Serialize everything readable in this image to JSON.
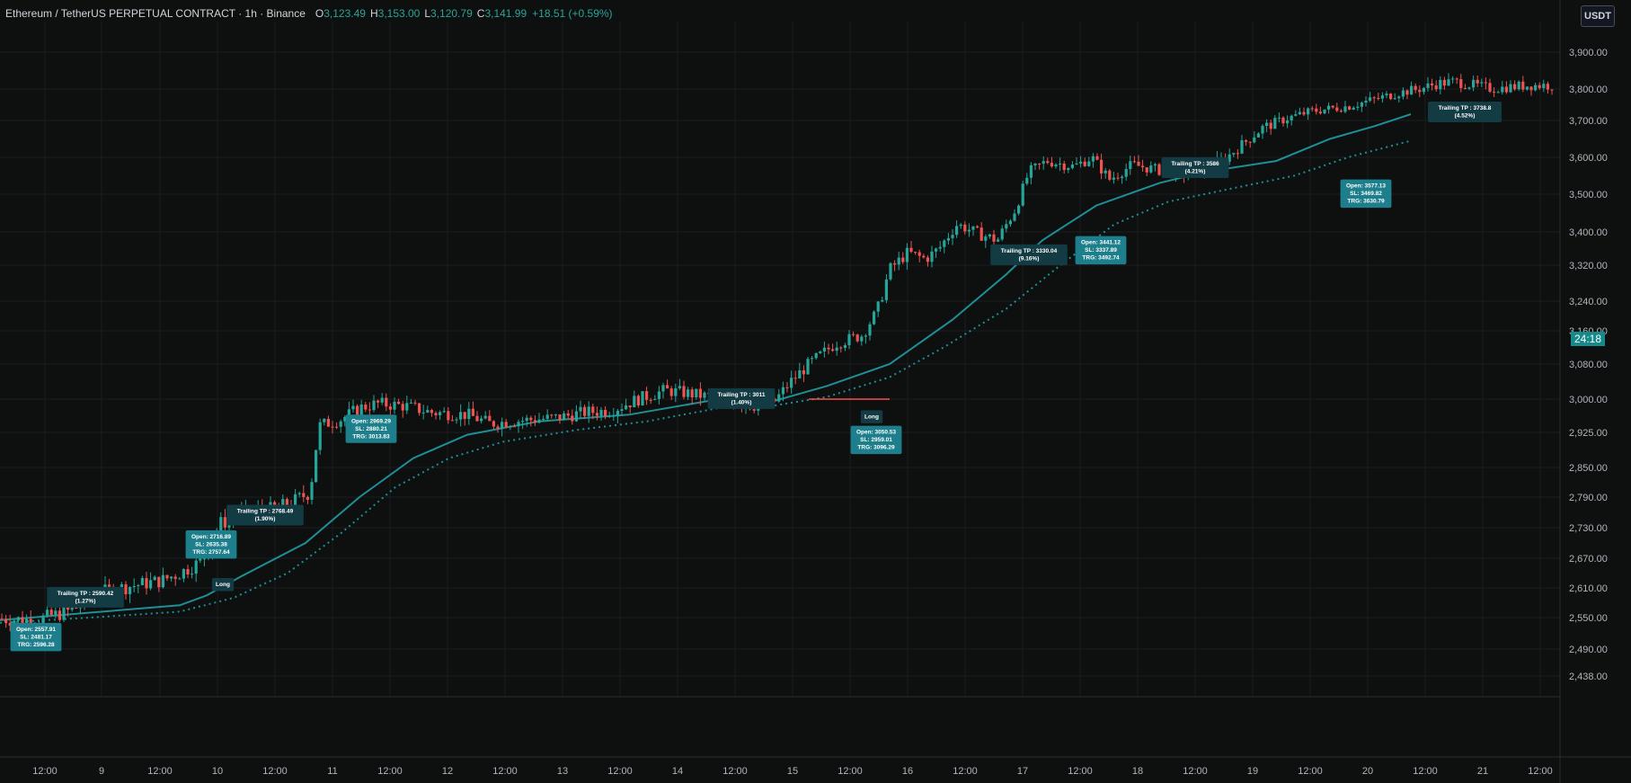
{
  "header": {
    "symbol": "Ethereum / TetherUS PERPETUAL CONTRACT · 1h · Binance",
    "ohlc": [
      {
        "k": "O",
        "v": "3,123.49"
      },
      {
        "k": "H",
        "v": "3,153.00"
      },
      {
        "k": "L",
        "v": "3,120.79"
      },
      {
        "k": "C",
        "v": "3,141.99"
      }
    ],
    "change": "+18.51 (+0.59%)"
  },
  "currency_button": "USDT",
  "countdown": "24:18",
  "colors": {
    "bull": "#26a69a",
    "bear": "#ef5350",
    "ma": "#1e8f96",
    "ann_bg": "#1d7f8c",
    "ann_bg_dark": "#133b44"
  },
  "chart_data": {
    "type": "candlestick",
    "price_axis": [
      "3,900.00",
      "3,800.00",
      "3,700.00",
      "3,600.00",
      "3,500.00",
      "3,400.00",
      "3,320.00",
      "3,240.00",
      "3,160.00",
      "3,080.00",
      "3,000.00",
      "2,925.00",
      "2,850.00",
      "2,790.00",
      "2,730.00",
      "2,670.00",
      "2,610.00",
      "2,550.00",
      "2,490.00",
      "2,438.00"
    ],
    "time_axis": [
      "12:00",
      "9",
      "12:00",
      "10",
      "12:00",
      "11",
      "12:00",
      "12",
      "12:00",
      "13",
      "12:00",
      "14",
      "12:00",
      "15",
      "12:00",
      "16",
      "12:00",
      "17",
      "12:00",
      "18",
      "12:00",
      "19",
      "12:00",
      "20",
      "12:00",
      "21",
      "12:00"
    ],
    "ylim": [
      2438,
      3900
    ],
    "price_path": [
      [
        0,
        2548
      ],
      [
        40,
        2545
      ],
      [
        80,
        2565
      ],
      [
        110,
        2600
      ],
      [
        140,
        2612
      ],
      [
        180,
        2625
      ],
      [
        200,
        2640
      ],
      [
        225,
        2665
      ],
      [
        245,
        2738
      ],
      [
        275,
        2760
      ],
      [
        300,
        2765
      ],
      [
        320,
        2775
      ],
      [
        345,
        2800
      ],
      [
        355,
        2940
      ],
      [
        380,
        2955
      ],
      [
        400,
        2980
      ],
      [
        420,
        2990
      ],
      [
        450,
        2985
      ],
      [
        480,
        2970
      ],
      [
        520,
        2965
      ],
      [
        545,
        2945
      ],
      [
        580,
        2952
      ],
      [
        620,
        2958
      ],
      [
        650,
        2970
      ],
      [
        680,
        2975
      ],
      [
        710,
        3000
      ],
      [
        740,
        3020
      ],
      [
        760,
        3015
      ],
      [
        790,
        3005
      ],
      [
        820,
        2990
      ],
      [
        845,
        2985
      ],
      [
        860,
        2990
      ],
      [
        880,
        3040
      ],
      [
        900,
        3080
      ],
      [
        930,
        3130
      ],
      [
        960,
        3150
      ],
      [
        975,
        3210
      ],
      [
        990,
        3310
      ],
      [
        1010,
        3350
      ],
      [
        1030,
        3335
      ],
      [
        1045,
        3360
      ],
      [
        1065,
        3420
      ],
      [
        1090,
        3395
      ],
      [
        1110,
        3380
      ],
      [
        1130,
        3460
      ],
      [
        1145,
        3560
      ],
      [
        1165,
        3590
      ],
      [
        1195,
        3575
      ],
      [
        1215,
        3600
      ],
      [
        1235,
        3540
      ],
      [
        1260,
        3580
      ],
      [
        1290,
        3565
      ],
      [
        1320,
        3555
      ],
      [
        1340,
        3570
      ],
      [
        1365,
        3600
      ],
      [
        1385,
        3640
      ],
      [
        1405,
        3680
      ],
      [
        1430,
        3705
      ],
      [
        1460,
        3730
      ],
      [
        1500,
        3745
      ],
      [
        1520,
        3760
      ],
      [
        1540,
        3775
      ],
      [
        1560,
        3790
      ],
      [
        1580,
        3800
      ],
      [
        1600,
        3815
      ],
      [
        1620,
        3820
      ],
      [
        1660,
        3800
      ],
      [
        1700,
        3810
      ],
      [
        1740,
        3810
      ]
    ],
    "ma_path": [
      [
        0,
        2545
      ],
      [
        100,
        2560
      ],
      [
        200,
        2575
      ],
      [
        230,
        2595
      ],
      [
        270,
        2635
      ],
      [
        340,
        2700
      ],
      [
        400,
        2790
      ],
      [
        460,
        2870
      ],
      [
        520,
        2920
      ],
      [
        600,
        2950
      ],
      [
        700,
        2965
      ],
      [
        800,
        3000
      ],
      [
        860,
        2995
      ],
      [
        920,
        3030
      ],
      [
        990,
        3080
      ],
      [
        1060,
        3190
      ],
      [
        1120,
        3300
      ],
      [
        1160,
        3380
      ],
      [
        1220,
        3470
      ],
      [
        1290,
        3530
      ],
      [
        1340,
        3560
      ],
      [
        1420,
        3590
      ],
      [
        1480,
        3650
      ],
      [
        1530,
        3685
      ],
      [
        1570,
        3720
      ]
    ],
    "ma2_path": [
      [
        0,
        2540
      ],
      [
        100,
        2550
      ],
      [
        200,
        2562
      ],
      [
        260,
        2590
      ],
      [
        320,
        2640
      ],
      [
        380,
        2720
      ],
      [
        440,
        2810
      ],
      [
        500,
        2870
      ],
      [
        560,
        2905
      ],
      [
        640,
        2930
      ],
      [
        720,
        2950
      ],
      [
        800,
        2980
      ],
      [
        860,
        2985
      ],
      [
        920,
        3005
      ],
      [
        990,
        3050
      ],
      [
        1050,
        3120
      ],
      [
        1120,
        3220
      ],
      [
        1180,
        3320
      ],
      [
        1240,
        3420
      ],
      [
        1300,
        3480
      ],
      [
        1360,
        3510
      ],
      [
        1440,
        3550
      ],
      [
        1500,
        3600
      ],
      [
        1570,
        3645
      ]
    ],
    "annotations": [
      {
        "dark": false,
        "lines": [
          "Open: 2557.91",
          "SL: 2481.17",
          "TRG: 2596.28"
        ],
        "x": 40,
        "y": 2540
      },
      {
        "dark": true,
        "lines": [
          "Trailing TP : 2590.42",
          "(1.27%)"
        ],
        "x": 95,
        "y": 2612
      },
      {
        "dark": false,
        "lines": [
          "Open: 2716.89",
          "SL: 2635.38",
          "TRG: 2757.64"
        ],
        "x": 235,
        "y": 2725
      },
      {
        "dark": true,
        "lines": [
          "Long"
        ],
        "x": 248,
        "y": 2630
      },
      {
        "dark": true,
        "lines": [
          "Trailing TP : 2768.49",
          "(1.90%)"
        ],
        "x": 295,
        "y": 2775
      },
      {
        "dark": false,
        "lines": [
          "Open: 2969.29",
          "SL: 2880.21",
          "TRG: 3013.83"
        ],
        "x": 413,
        "y": 2965
      },
      {
        "dark": true,
        "lines": [
          "Trailing TP : 3011",
          "(1.40%)"
        ],
        "x": 825,
        "y": 3025
      },
      {
        "dark": true,
        "lines": [
          "Long"
        ],
        "x": 970,
        "y": 2975
      },
      {
        "dark": false,
        "lines": [
          "Open: 3050.53",
          "SL: 2959.01",
          "TRG: 3096.29"
        ],
        "x": 975,
        "y": 2940
      },
      {
        "dark": true,
        "lines": [
          "Trailing TP : 3330.04",
          "(9.16%)"
        ],
        "x": 1145,
        "y": 3370
      },
      {
        "dark": false,
        "lines": [
          "Open: 3441.12",
          "SL: 3337.89",
          "TRG: 3492.74"
        ],
        "x": 1225,
        "y": 3390
      },
      {
        "dark": true,
        "lines": [
          "Trailing TP : 3586",
          "(4.21%)"
        ],
        "x": 1330,
        "y": 3600
      },
      {
        "dark": false,
        "lines": [
          "Open: 3577.13",
          "SL: 3469.82",
          "TRG: 3630.79"
        ],
        "x": 1520,
        "y": 3540
      },
      {
        "dark": true,
        "lines": [
          "Trailing TP : 3738.8",
          "(4.52%)"
        ],
        "x": 1630,
        "y": 3760
      }
    ]
  }
}
